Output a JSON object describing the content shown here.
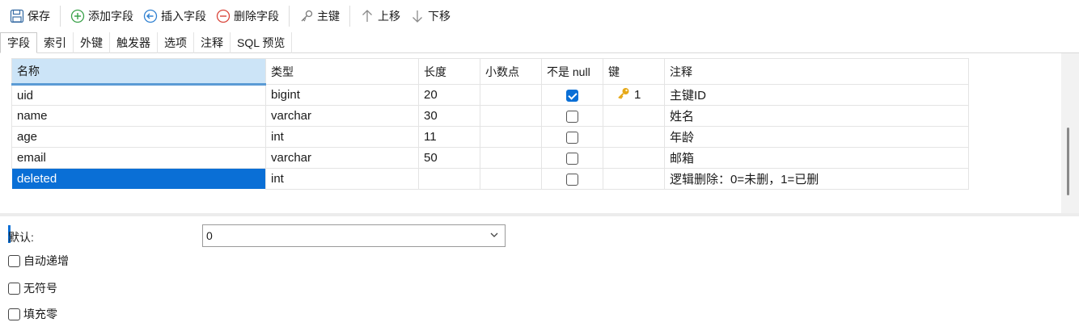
{
  "toolbar": {
    "save": "保存",
    "add_field": "添加字段",
    "insert_field": "插入字段",
    "delete_field": "删除字段",
    "primary_key": "主键",
    "move_up": "上移",
    "move_down": "下移"
  },
  "tabs": [
    "字段",
    "索引",
    "外键",
    "触发器",
    "选项",
    "注释",
    "SQL 预览"
  ],
  "grid": {
    "headers": [
      "名称",
      "类型",
      "长度",
      "小数点",
      "不是 null",
      "键",
      "注释"
    ],
    "rows": [
      {
        "name": "uid",
        "type": "bigint",
        "length": "20",
        "decimals": "",
        "not_null": true,
        "key": "1",
        "comment": "主键ID"
      },
      {
        "name": "name",
        "type": "varchar",
        "length": "30",
        "decimals": "",
        "not_null": false,
        "key": "",
        "comment": "姓名"
      },
      {
        "name": "age",
        "type": "int",
        "length": "11",
        "decimals": "",
        "not_null": false,
        "key": "",
        "comment": "年龄"
      },
      {
        "name": "email",
        "type": "varchar",
        "length": "50",
        "decimals": "",
        "not_null": false,
        "key": "",
        "comment": "邮箱"
      },
      {
        "name": "deleted",
        "type": "int",
        "length": "",
        "decimals": "",
        "not_null": false,
        "key": "",
        "comment": "逻辑删除：0=未删，1=已删"
      }
    ]
  },
  "properties": {
    "default_label": "默认:",
    "default_value": "0",
    "auto_increment": "自动递增",
    "unsigned": "无符号",
    "zerofill": "填充零"
  },
  "colors": {
    "accent": "#0a6fd6",
    "header_selected": "#cce4f7",
    "key_icon": "#e6a817"
  }
}
